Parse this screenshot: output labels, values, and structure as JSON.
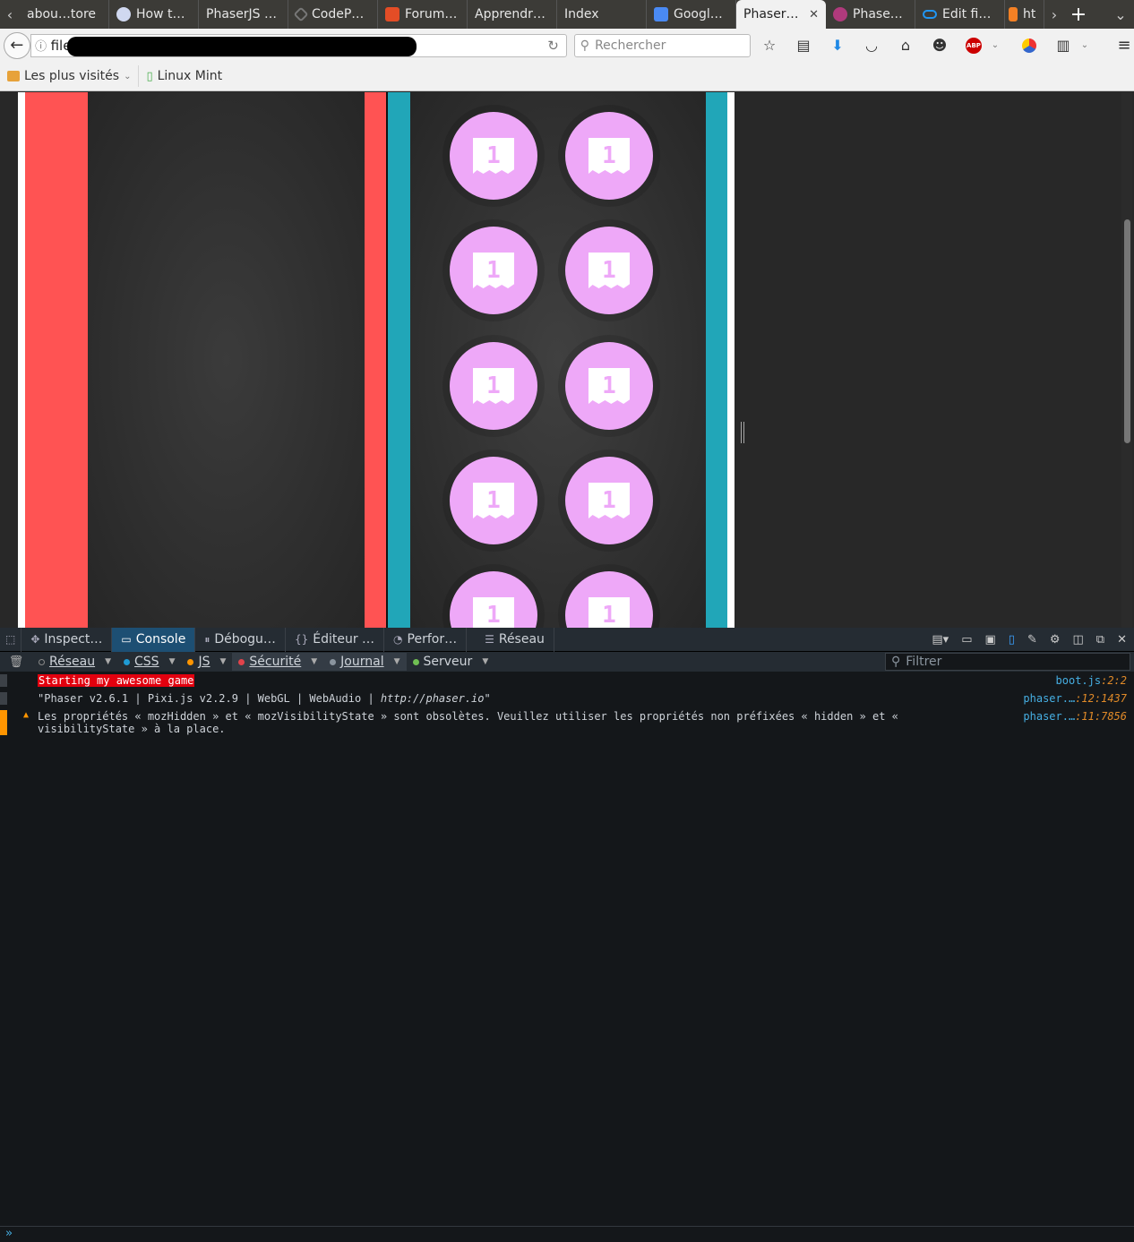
{
  "tabs": [
    {
      "label": "abou…tore",
      "icon": "firefox-icon",
      "color": "#3c3b37"
    },
    {
      "label": "How t…",
      "icon": "penguin-icon",
      "color": "#ffffff"
    },
    {
      "label": "PhaserJS …",
      "icon": "",
      "color": "#3c3b37"
    },
    {
      "label": "CodeP…",
      "icon": "codepen-icon",
      "color": "#666666"
    },
    {
      "label": "Forum…",
      "icon": "html5-icon",
      "color": "#e44d26"
    },
    {
      "label": "Apprendr…",
      "icon": "",
      "color": "#3c3b37"
    },
    {
      "label": "Index",
      "icon": "",
      "color": "#3c3b37"
    },
    {
      "label": "Googl…",
      "icon": "google-translate-icon",
      "color": "#4a8af4"
    },
    {
      "label": "Phaser…",
      "icon": "",
      "color": "#f1f1f1",
      "active": true
    },
    {
      "label": "Phase…",
      "icon": "phaser-icon",
      "color": "#b03a7c"
    },
    {
      "label": "Edit fi…",
      "icon": "cloud-icon",
      "color": "#2196f3"
    },
    {
      "label": "ht",
      "icon": "stackoverflow-icon",
      "color": "#f48024"
    }
  ],
  "nav": {
    "url_prefix": "file:/",
    "search_placeholder": "Rechercher"
  },
  "bookmarks": {
    "most_visited": "Les plus visités",
    "linux_mint": "Linux Mint"
  },
  "game": {
    "token_label": "1",
    "token_color": "#eea8f8",
    "lane_red": "#ff5353",
    "lane_teal": "#21a6b8"
  },
  "devtools": {
    "tabs": [
      {
        "label": "Inspect…",
        "icon": "inspector-icon"
      },
      {
        "label": "Console",
        "icon": "console-icon",
        "active": true
      },
      {
        "label": "Débogu…",
        "icon": "debugger-icon"
      },
      {
        "label": "Éditeur …",
        "icon": "style-editor-icon"
      },
      {
        "label": "Perfor…",
        "icon": "performance-icon"
      },
      {
        "label": "Réseau",
        "icon": "network-icon"
      }
    ],
    "filters": [
      {
        "label": "Réseau",
        "dot": "#888888"
      },
      {
        "label": "CSS",
        "dot": "#1f9bd4"
      },
      {
        "label": "JS",
        "dot": "#ff9500"
      },
      {
        "label": "Sécurité",
        "dot": "#e2434b",
        "on": true
      },
      {
        "label": "Journal",
        "dot": "#8a949e",
        "on": true
      },
      {
        "label": "Serveur",
        "dot": "#70bf53"
      }
    ],
    "filter_placeholder": "Filtrer"
  },
  "console": [
    {
      "type": "log",
      "text": "Starting my awesome game",
      "file": "boot.js",
      "loc": ":2:2"
    },
    {
      "type": "log",
      "text": "\"Phaser v2.6.1 | Pixi.js v2.2.9 | WebGL | WebAudio | ",
      "link": "http://phaser.io",
      "tail": "\"",
      "file": "phaser.…",
      "loc": ":12:1437"
    },
    {
      "type": "warn",
      "text": "Les propriétés « mozHidden » et « mozVisibilityState » sont obsolètes. Veuillez utiliser les propriétés non préfixées « hidden » et « visibilityState » à la place.",
      "file": "phaser.…",
      "loc": ":11:7856"
    }
  ],
  "cmdline_prompt": "»"
}
